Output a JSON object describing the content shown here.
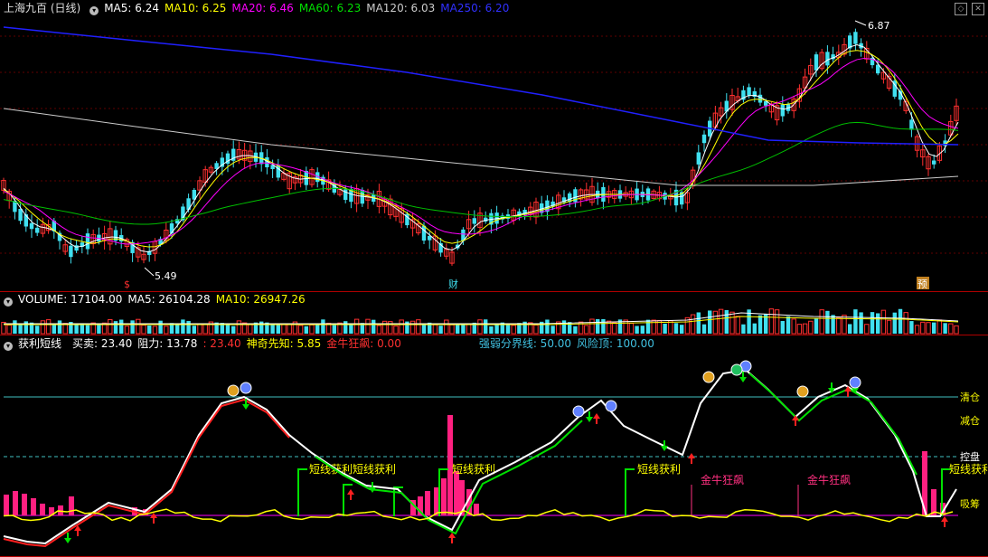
{
  "main": {
    "title": "上海九百 (日线)",
    "ma": [
      {
        "label": "MA5: 6.24",
        "color": "#ffffff"
      },
      {
        "label": "MA10: 6.25",
        "color": "#ffff00"
      },
      {
        "label": "MA20: 6.46",
        "color": "#ff00ff"
      },
      {
        "label": "MA60: 6.23",
        "color": "#00e000"
      },
      {
        "label": "MA120: 6.03",
        "color": "#cccccc"
      },
      {
        "label": "MA250: 6.20",
        "color": "#3030ff"
      }
    ],
    "high_label": "6.87",
    "low_label": "5.49",
    "marker_s": "$",
    "marker_cai": "财",
    "marker_yu": "预"
  },
  "volume": {
    "label": "VOLUME: 17104.00",
    "ma5": "MA5: 26104.28",
    "ma10": "MA10: 26947.26"
  },
  "indicator": {
    "name": "获利短线",
    "items": [
      {
        "label": "买卖: 23.40",
        "color": "#ffffff"
      },
      {
        "label": "阻力: 13.78",
        "color": "#ffffff"
      },
      {
        "label": ": 23.40",
        "color": "#ff3030"
      },
      {
        "label": "神奇先知: 5.85",
        "color": "#ffff00"
      },
      {
        "label": "金牛狂飙: 0.00",
        "color": "#ff3030"
      },
      {
        "label": "强弱分界线: 50.00",
        "color": "#40c0e0"
      },
      {
        "label": "风险顶: 100.00",
        "color": "#40c0e0"
      }
    ],
    "levels": {
      "qingcang": "清仓",
      "jiancang": "减仓",
      "kongpan": "控盘",
      "xichou": "吸筹"
    },
    "signals": {
      "duanxian": "短线获利",
      "jinniu": "金牛狂飙"
    }
  }
}
